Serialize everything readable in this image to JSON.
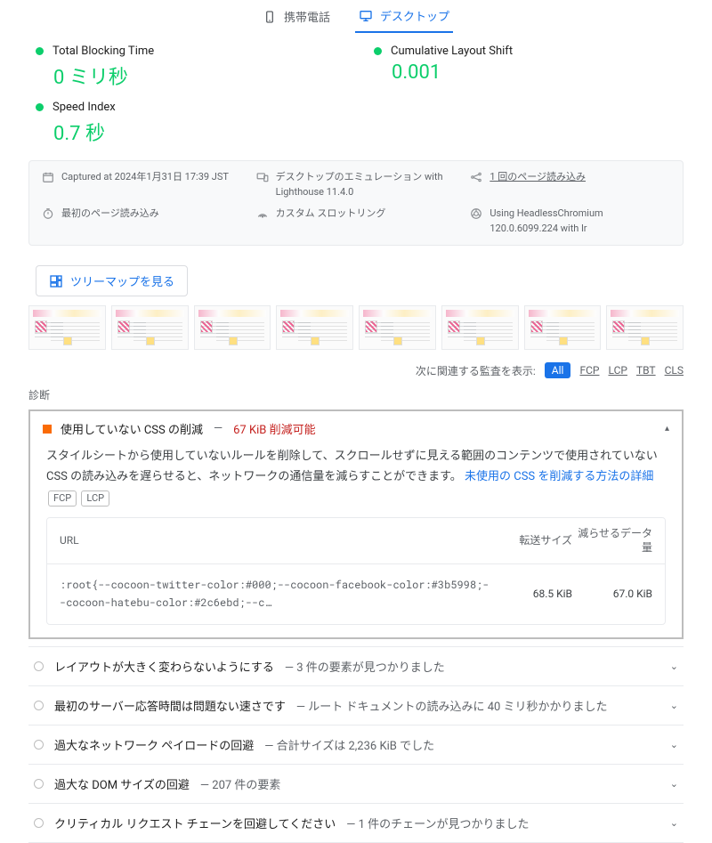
{
  "tabs": {
    "mobile": "携帯電話",
    "desktop": "デスクトップ"
  },
  "metrics": {
    "tbt": {
      "label": "Total Blocking Time",
      "value": "0 ミリ秒"
    },
    "cls": {
      "label": "Cumulative Layout Shift",
      "value": "0.001"
    },
    "si": {
      "label": "Speed Index",
      "value": "0.7 秒"
    }
  },
  "env": {
    "captured": "Captured at 2024年1月31日 17:39 JST",
    "emulation": "デスクトップのエミュレーション with Lighthouse 11.4.0",
    "pageload1": "1 回のページ読み込み",
    "initial": "最初のページ読み込み",
    "throttle": "カスタム スロットリング",
    "browser": "Using HeadlessChromium 120.0.6099.224 with lr"
  },
  "treemap_label": "ツリーマップを見る",
  "filter": {
    "label": "次に関連する監査を表示:",
    "all": "All",
    "fcp": "FCP",
    "lcp": "LCP",
    "tbt": "TBT",
    "cls": "CLS"
  },
  "diagnostics_label": "診断",
  "open_audit": {
    "title": "使用していない CSS の削減",
    "savings": "67 KiB 削減可能",
    "dash": "—",
    "desc1": "スタイルシートから使用していないルールを削除して、スクロールせずに見える範囲のコンテンツで使用されていない CSS の読み込みを遅らせると、ネットワークの通信量を減らすことができます。",
    "learn_more": "未使用の CSS を削減する方法の詳細",
    "badge1": "FCP",
    "badge2": "LCP",
    "col_url": "URL",
    "col_xfer": "転送サイズ",
    "col_save": "減らせるデータ量",
    "row_code": ":root{--cocoon-twitter-color:#000;--cocoon-facebook-color:#3b5998;--cocoon-hatebu-color:#2c6ebd;--c…",
    "row_xfer": "68.5 KiB",
    "row_save": "67.0 KiB"
  },
  "closed_audits": [
    {
      "title": "レイアウトが大きく変わらないようにする",
      "sub": "3 件の要素が見つかりました"
    },
    {
      "title": "最初のサーバー応答時間は問題ない速さです",
      "sub": "ルート ドキュメントの読み込みに 40 ミリ秒かかりました"
    },
    {
      "title": "過大なネットワーク ペイロードの回避",
      "sub": "合計サイズは 2,236 KiB でした"
    },
    {
      "title": "過大な DOM サイズの回避",
      "sub": "207 件の要素"
    },
    {
      "title": "クリティカル リクエスト チェーンを回避してください",
      "sub": "1 件のチェーンが見つかりました"
    }
  ],
  "dash": "—"
}
